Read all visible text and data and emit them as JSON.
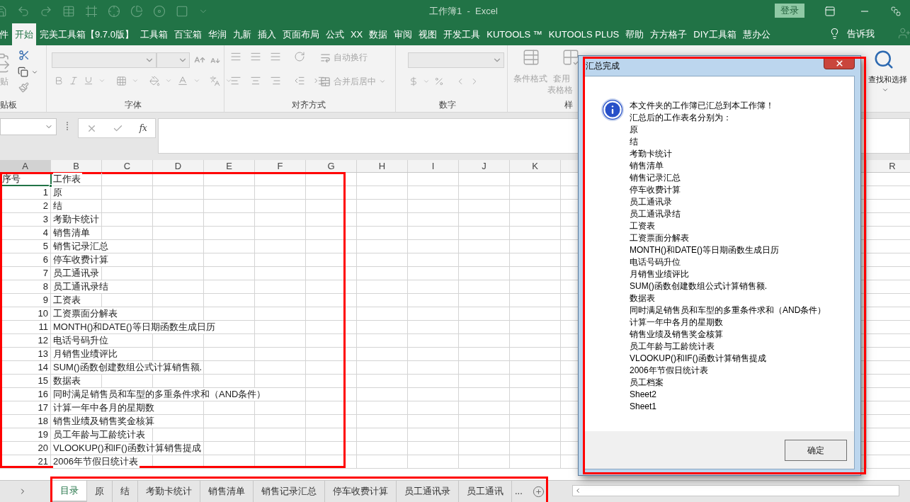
{
  "title_bar": {
    "title": "工作簿1  -  Excel",
    "login_button": "登录"
  },
  "ribbon_tabs": [
    {
      "label": "件",
      "selected": false
    },
    {
      "label": "开始",
      "selected": true
    },
    {
      "label": "完美工具箱【9.7.0版】",
      "selected": false
    },
    {
      "label": "工具箱",
      "selected": false
    },
    {
      "label": "百宝箱",
      "selected": false
    },
    {
      "label": "华润",
      "selected": false
    },
    {
      "label": "九新",
      "selected": false
    },
    {
      "label": "插入",
      "selected": false
    },
    {
      "label": "页面布局",
      "selected": false
    },
    {
      "label": "公式",
      "selected": false
    },
    {
      "label": "XX",
      "selected": false
    },
    {
      "label": "数据",
      "selected": false
    },
    {
      "label": "审阅",
      "selected": false
    },
    {
      "label": "视图",
      "selected": false
    },
    {
      "label": "开发工具",
      "selected": false
    },
    {
      "label": "KUTOOLS ™",
      "selected": false
    },
    {
      "label": "KUTOOLS PLUS",
      "selected": false
    },
    {
      "label": "帮助",
      "selected": false
    },
    {
      "label": "方方格子",
      "selected": false
    },
    {
      "label": "DIY工具箱",
      "selected": false
    },
    {
      "label": "慧办公",
      "selected": false
    }
  ],
  "tell_me": "告诉我",
  "ribbon": {
    "paste_label": "贴",
    "clipboard_group": "贴板",
    "font_group": "字体",
    "alignment_group": "对齐方式",
    "wrap_text": "自动换行",
    "merge_center": "合并后居中",
    "number_group": "数字",
    "conditional_format": "条件格式",
    "table_format_line1": "套用",
    "table_format_line2": "表格格",
    "styles_group": "样",
    "find_select": "查找和选择"
  },
  "formula_bar": {
    "insert_function": "fx"
  },
  "columns": [
    "A",
    "B",
    "C",
    "D",
    "E",
    "F",
    "G",
    "H",
    "I",
    "J",
    "K"
  ],
  "right_column": "R",
  "rows": [
    {
      "kind": "header",
      "a": "序号",
      "b": "工作表",
      "selected": true
    },
    {
      "kind": "item",
      "a": "1",
      "b": "原",
      "selected": false
    },
    {
      "kind": "item",
      "a": "2",
      "b": "结",
      "selected": false
    },
    {
      "kind": "item",
      "a": "3",
      "b": "考勤卡统计",
      "selected": false
    },
    {
      "kind": "item",
      "a": "4",
      "b": "销售清单",
      "selected": false
    },
    {
      "kind": "item",
      "a": "5",
      "b": "销售记录汇总",
      "selected": false
    },
    {
      "kind": "item",
      "a": "6",
      "b": "停车收费计算",
      "selected": false
    },
    {
      "kind": "item",
      "a": "7",
      "b": "员工通讯录",
      "selected": false
    },
    {
      "kind": "item",
      "a": "8",
      "b": "员工通讯录结",
      "selected": false
    },
    {
      "kind": "item",
      "a": "9",
      "b": "工资表",
      "selected": false
    },
    {
      "kind": "item",
      "a": "10",
      "b": "工资票面分解表",
      "selected": false
    },
    {
      "kind": "item",
      "a": "11",
      "b": "MONTH()和DATE()等日期函数生成日历",
      "selected": false
    },
    {
      "kind": "item",
      "a": "12",
      "b": "电话号码升位",
      "selected": false
    },
    {
      "kind": "item",
      "a": "13",
      "b": "月销售业绩评比",
      "selected": false
    },
    {
      "kind": "item",
      "a": "14",
      "b": "SUM()函数创建数组公式计算销售额.",
      "selected": false
    },
    {
      "kind": "item",
      "a": "15",
      "b": "数据表",
      "selected": false
    },
    {
      "kind": "item",
      "a": "16",
      "b": "同时满足销售员和车型的多重条件求和（AND条件）",
      "selected": false
    },
    {
      "kind": "item",
      "a": "17",
      "b": "计算一年中各月的星期数",
      "selected": false
    },
    {
      "kind": "item",
      "a": "18",
      "b": "销售业绩及销售奖金核算",
      "selected": false
    },
    {
      "kind": "item",
      "a": "19",
      "b": "员工年龄与工龄统计表",
      "selected": false
    },
    {
      "kind": "item",
      "a": "20",
      "b": "VLOOKUP()和IF()函数计算销售提成",
      "selected": false
    },
    {
      "kind": "item",
      "a": "21",
      "b": "2006年节假日统计表",
      "selected": false
    }
  ],
  "dialog": {
    "title": "汇总完成",
    "message": [
      "本文件夹的工作簿已汇总到本工作簿！",
      "汇总后的工作表名分别为："
    ],
    "sheet_names": [
      "原",
      "结",
      "考勤卡统计",
      "销售清单",
      "销售记录汇总",
      "停车收费计算",
      "员工通讯录",
      "员工通讯录结",
      "工资表",
      "工资票面分解表",
      "MONTH()和DATE()等日期函数生成日历",
      "电话号码升位",
      "月销售业绩评比",
      "SUM()函数创建数组公式计算销售额.",
      "数据表",
      "同时满足销售员和车型的多重条件求和（AND条件）",
      "计算一年中各月的星期数",
      "销售业绩及销售奖金核算",
      "员工年龄与工龄统计表",
      "VLOOKUP()和IF()函数计算销售提成",
      "2006年节假日统计表",
      "员工档案",
      "Sheet2",
      "Sheet1"
    ],
    "ok_button": "确定"
  },
  "sheet_tabs": [
    {
      "label": "目录",
      "selected": true
    },
    {
      "label": "原",
      "selected": false
    },
    {
      "label": "结",
      "selected": false
    },
    {
      "label": "考勤卡统计",
      "selected": false
    },
    {
      "label": "销售清单",
      "selected": false
    },
    {
      "label": "销售记录汇总",
      "selected": false
    },
    {
      "label": "停车收费计算",
      "selected": false
    },
    {
      "label": "员工通讯录",
      "selected": false
    },
    {
      "label": "员工通讯",
      "selected": false
    }
  ],
  "more_tabs": "..."
}
